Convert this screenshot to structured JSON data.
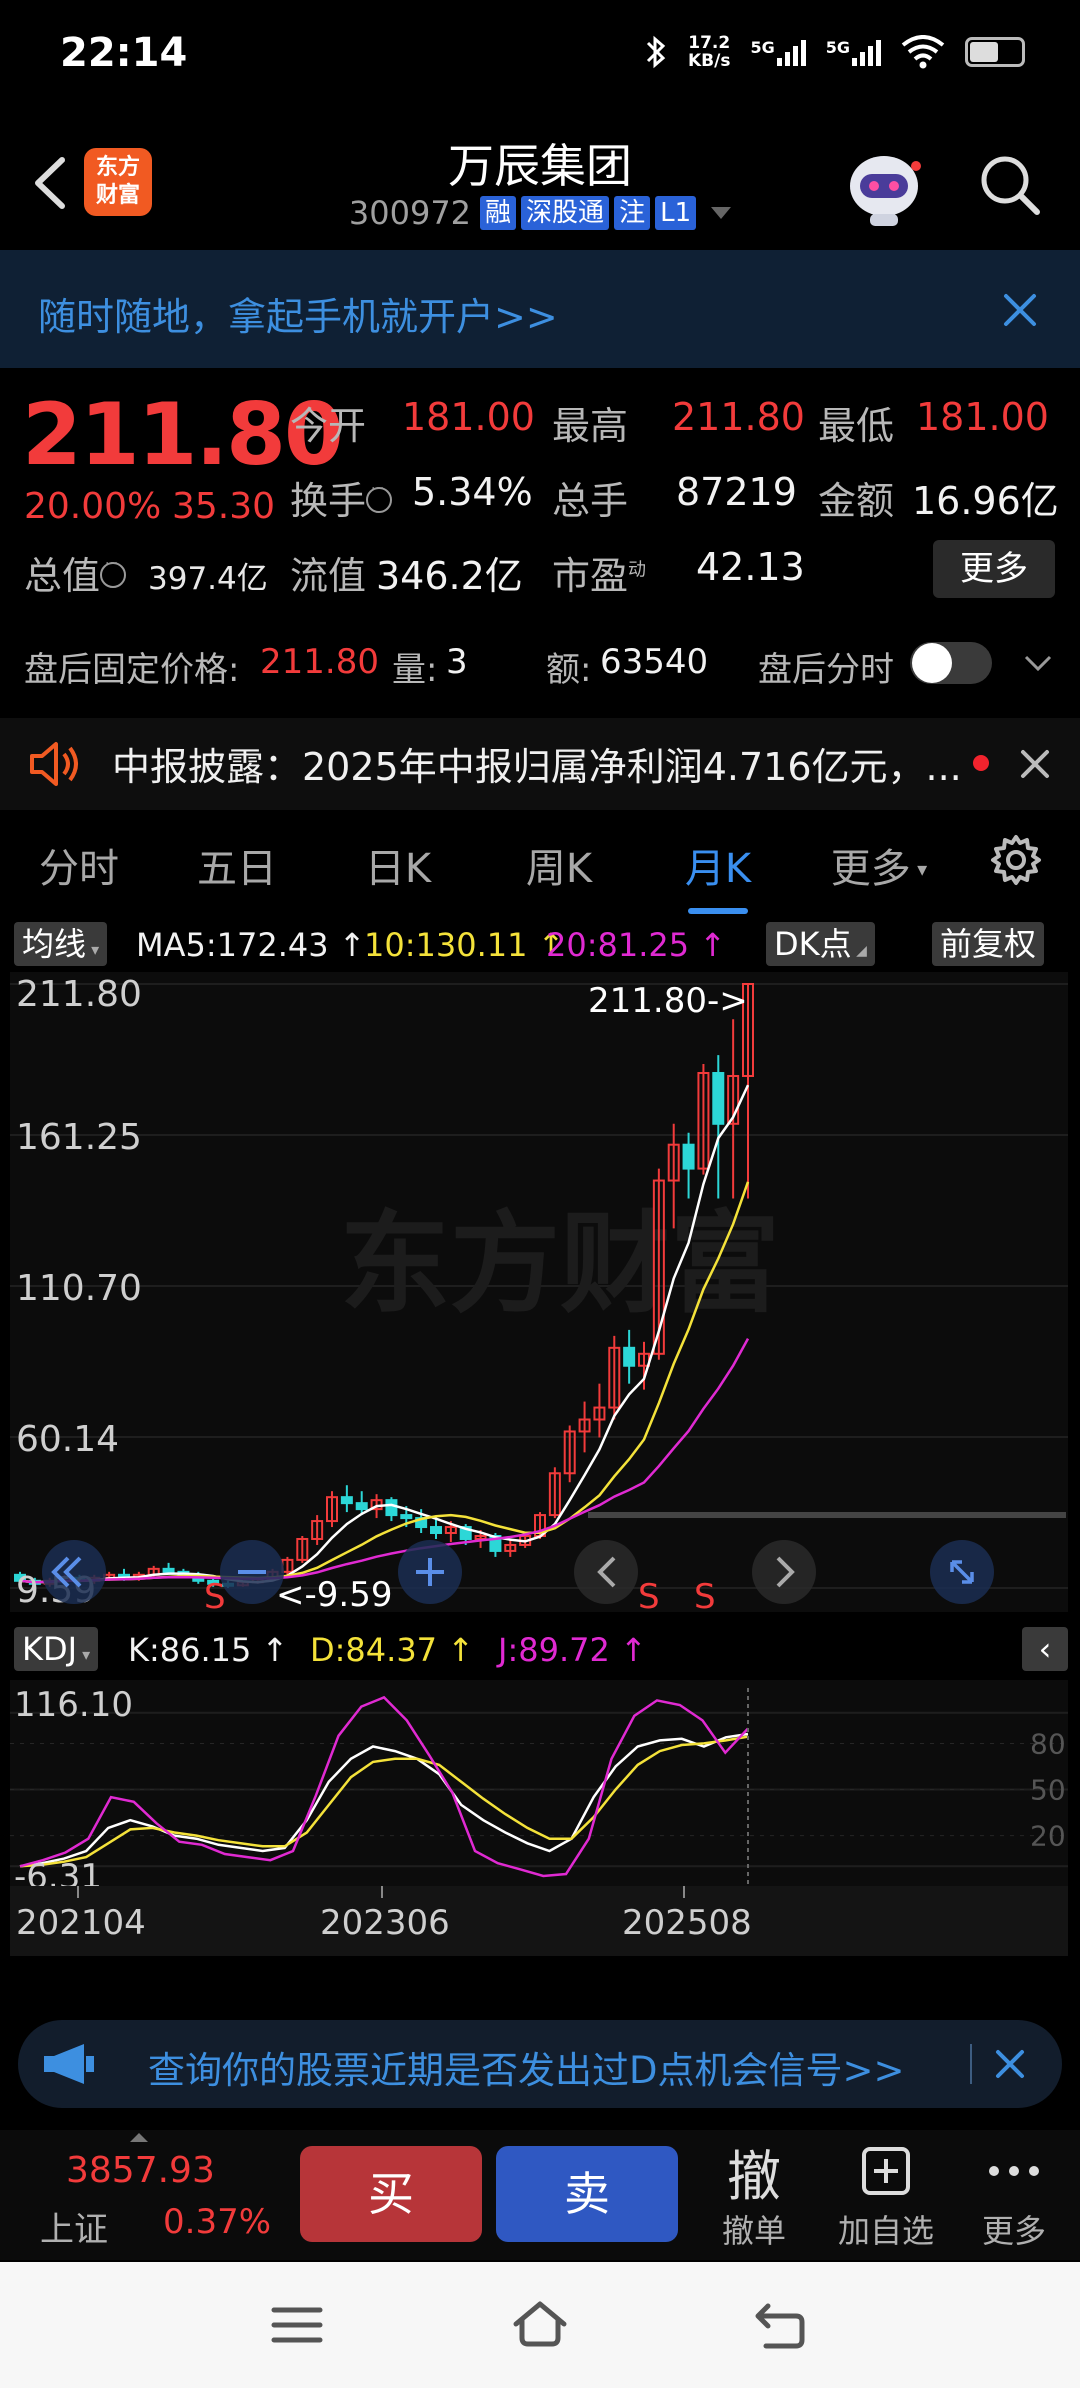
{
  "status": {
    "time": "22:14",
    "speed_value": "17.2",
    "speed_unit": "KB/s",
    "sig1": "5G",
    "sig2": "5G"
  },
  "header": {
    "logo_line1": "东方",
    "logo_line2": "财富",
    "title": "万辰集团",
    "code": "300972",
    "tags": [
      "融",
      "深股通",
      "注",
      "L1"
    ]
  },
  "banner": {
    "text": "随时随地，拿起手机就开户>>"
  },
  "quote": {
    "price": "211.80",
    "pct": "20.00%",
    "change": "35.30",
    "open_label": "今开",
    "open": "181.00",
    "high_label": "最高",
    "high": "211.80",
    "low_label": "最低",
    "low": "181.00",
    "turnover_label": "换手",
    "turnover": "5.34%",
    "volume_label": "总手",
    "volume": "87219",
    "amount_label": "金额",
    "amount": "16.96亿",
    "cap_label": "总值",
    "cap": "397.4亿",
    "float_label": "流值",
    "float": "346.2亿",
    "pe_label": "市盈",
    "pe_sup": "动",
    "pe": "42.13",
    "more": "更多"
  },
  "afterhours": {
    "price_label": "盘后固定价格:",
    "price": "211.80",
    "vol_label": "量:",
    "vol": "3",
    "amt_label": "额:",
    "amt": "63540",
    "time_label": "盘后分时"
  },
  "news": {
    "text": "中报披露：2025年中报归属净利润4.716亿元，..."
  },
  "tabs": [
    "分时",
    "五日",
    "日K",
    "周K",
    "月K",
    "更多"
  ],
  "ma": {
    "selector": "均线",
    "ma5": "MA5:172.43 ↑",
    "ma10": "10:130.11 ↑",
    "ma20": "20:81.25 ↑",
    "dk": "DK点",
    "adjust": "前复权"
  },
  "kdj": {
    "selector": "KDJ",
    "k": "K:86.15 ↑",
    "d": "D:84.37 ↑",
    "j": "J:89.72 ↑"
  },
  "chart_data": [
    {
      "type": "candlestick",
      "title": "",
      "y_ticks": [
        "211.80",
        "161.25",
        "110.70",
        "60.14",
        "9.59"
      ],
      "ylim": [
        9.59,
        211.8
      ],
      "annotations": {
        "high_marker": "211.80->",
        "low_marker": "<-9.59",
        "signals": [
          "S",
          "S",
          "S"
        ]
      },
      "watermark": "东方财富",
      "candles": [
        {
          "o": 14,
          "h": 15,
          "l": 11,
          "c": 12
        },
        {
          "o": 12,
          "h": 13,
          "l": 10,
          "c": 11
        },
        {
          "o": 11,
          "h": 13,
          "l": 10,
          "c": 12
        },
        {
          "o": 12,
          "h": 14,
          "l": 11,
          "c": 13
        },
        {
          "o": 13,
          "h": 14,
          "l": 11,
          "c": 12
        },
        {
          "o": 12,
          "h": 14,
          "l": 11,
          "c": 13
        },
        {
          "o": 13,
          "h": 15,
          "l": 12,
          "c": 14
        },
        {
          "o": 14,
          "h": 16,
          "l": 12,
          "c": 13
        },
        {
          "o": 13,
          "h": 15,
          "l": 12,
          "c": 14
        },
        {
          "o": 14,
          "h": 17,
          "l": 13,
          "c": 16
        },
        {
          "o": 16,
          "h": 18,
          "l": 14,
          "c": 15
        },
        {
          "o": 15,
          "h": 16,
          "l": 13,
          "c": 14
        },
        {
          "o": 14,
          "h": 15,
          "l": 11,
          "c": 12
        },
        {
          "o": 12,
          "h": 13,
          "l": 10,
          "c": 11
        },
        {
          "o": 11,
          "h": 12,
          "l": 9.59,
          "c": 10.5
        },
        {
          "o": 10.5,
          "h": 12,
          "l": 10,
          "c": 11.5
        },
        {
          "o": 11.5,
          "h": 13,
          "l": 11,
          "c": 12.5
        },
        {
          "o": 12.5,
          "h": 16,
          "l": 12,
          "c": 15
        },
        {
          "o": 15,
          "h": 20,
          "l": 14,
          "c": 19
        },
        {
          "o": 19,
          "h": 27,
          "l": 18,
          "c": 26
        },
        {
          "o": 26,
          "h": 34,
          "l": 24,
          "c": 32
        },
        {
          "o": 32,
          "h": 42,
          "l": 30,
          "c": 40
        },
        {
          "o": 40,
          "h": 44,
          "l": 35,
          "c": 38
        },
        {
          "o": 38,
          "h": 42,
          "l": 34,
          "c": 36
        },
        {
          "o": 36,
          "h": 41,
          "l": 33,
          "c": 39
        },
        {
          "o": 39,
          "h": 40,
          "l": 32,
          "c": 34
        },
        {
          "o": 34,
          "h": 37,
          "l": 30,
          "c": 33
        },
        {
          "o": 33,
          "h": 36,
          "l": 28,
          "c": 30
        },
        {
          "o": 30,
          "h": 33,
          "l": 26,
          "c": 28
        },
        {
          "o": 28,
          "h": 32,
          "l": 25,
          "c": 30
        },
        {
          "o": 30,
          "h": 31,
          "l": 24,
          "c": 26
        },
        {
          "o": 26,
          "h": 29,
          "l": 23,
          "c": 27
        },
        {
          "o": 27,
          "h": 28,
          "l": 20,
          "c": 22
        },
        {
          "o": 22,
          "h": 26,
          "l": 20,
          "c": 24
        },
        {
          "o": 24,
          "h": 28,
          "l": 23,
          "c": 27
        },
        {
          "o": 27,
          "h": 35,
          "l": 26,
          "c": 34
        },
        {
          "o": 34,
          "h": 50,
          "l": 33,
          "c": 48
        },
        {
          "o": 48,
          "h": 64,
          "l": 45,
          "c": 62
        },
        {
          "o": 62,
          "h": 72,
          "l": 55,
          "c": 66
        },
        {
          "o": 66,
          "h": 78,
          "l": 60,
          "c": 70
        },
        {
          "o": 70,
          "h": 94,
          "l": 66,
          "c": 90
        },
        {
          "o": 90,
          "h": 96,
          "l": 78,
          "c": 84
        },
        {
          "o": 84,
          "h": 92,
          "l": 76,
          "c": 88
        },
        {
          "o": 88,
          "h": 150,
          "l": 86,
          "c": 146
        },
        {
          "o": 146,
          "h": 165,
          "l": 130,
          "c": 158
        },
        {
          "o": 158,
          "h": 162,
          "l": 140,
          "c": 150
        },
        {
          "o": 150,
          "h": 185,
          "l": 148,
          "c": 182
        },
        {
          "o": 182,
          "h": 188,
          "l": 140,
          "c": 165
        },
        {
          "o": 165,
          "h": 200,
          "l": 140,
          "c": 181
        },
        {
          "o": 181,
          "h": 211.8,
          "l": 140,
          "c": 211.8
        }
      ]
    },
    {
      "type": "line",
      "title": "KDJ",
      "y_ticks": [
        "116.10",
        "-6.31"
      ],
      "right_ticks": [
        "80",
        "50",
        "20"
      ],
      "ylim": [
        -6.31,
        116.1
      ],
      "x_ticks": [
        "202104",
        "202306",
        "202508"
      ],
      "series": [
        {
          "name": "K",
          "color": "#ffffff",
          "values": [
            0,
            2,
            5,
            10,
            25,
            30,
            26,
            20,
            18,
            14,
            12,
            10,
            12,
            30,
            55,
            70,
            78,
            75,
            70,
            60,
            40,
            30,
            22,
            15,
            10,
            18,
            45,
            65,
            78,
            82,
            83,
            78,
            84,
            86.15
          ]
        },
        {
          "name": "D",
          "color": "#f4e23a",
          "values": [
            0,
            1,
            3,
            6,
            15,
            24,
            25,
            22,
            20,
            17,
            15,
            13,
            13,
            22,
            40,
            58,
            68,
            70,
            70,
            66,
            55,
            44,
            34,
            25,
            18,
            18,
            32,
            50,
            66,
            75,
            79,
            80,
            82,
            84.37
          ]
        },
        {
          "name": "J",
          "color": "#e02ad2",
          "values": [
            0,
            4,
            9,
            18,
            45,
            42,
            28,
            16,
            14,
            8,
            6,
            4,
            10,
            46,
            85,
            104,
            110,
            95,
            72,
            48,
            10,
            2,
            -2,
            -6.31,
            -5,
            18,
            70,
            98,
            108,
            105,
            95,
            74,
            89.72
          ]
        }
      ]
    }
  ],
  "promo": {
    "text": "查询你的股票近期是否发出过D点机会信号>>"
  },
  "toolbar": {
    "index_price": "3857.93",
    "index_name": "上证",
    "index_pct": "0.37%",
    "buy": "买",
    "sell": "卖",
    "cancel_icon": "撤",
    "cancel": "撤单",
    "watch": "加自选",
    "more": "更多"
  }
}
